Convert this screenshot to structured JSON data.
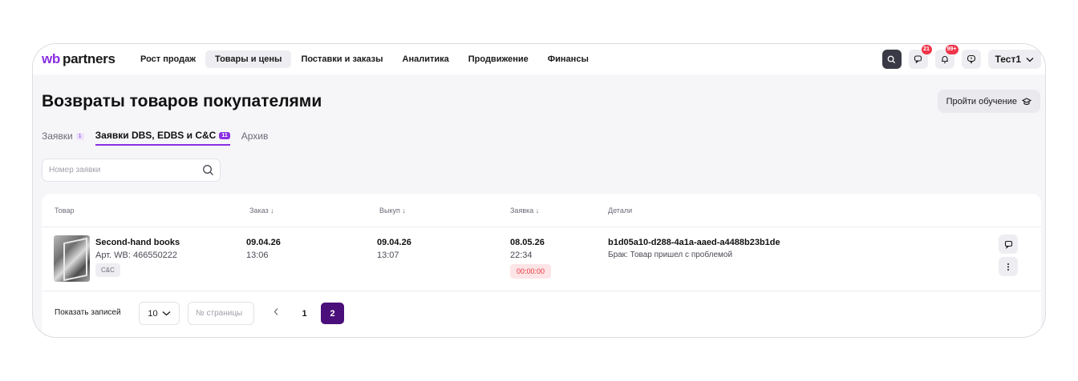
{
  "logo": {
    "wb": "wb",
    "partners": "partners"
  },
  "nav": [
    "Рост продаж",
    "Товары и цены",
    "Поставки и заказы",
    "Аналитика",
    "Продвижение",
    "Финансы"
  ],
  "nav_active_index": 1,
  "topbar": {
    "chat_badge": "21",
    "bell_badge": "99+",
    "user": "Тест1"
  },
  "page": {
    "title": "Возвраты товаров покупателями",
    "learn_button": "Пройти обучение"
  },
  "tabs": [
    {
      "label": "Заявки",
      "count": "1"
    },
    {
      "label": "Заявки DBS, EDBS и C&C",
      "count": "11"
    },
    {
      "label": "Архив"
    }
  ],
  "search": {
    "placeholder": "Номер заявки"
  },
  "table": {
    "headers": {
      "product": "Товар",
      "order": "Заказ ↓",
      "buyout": "Выкуп ↓",
      "request": "Заявка ↓",
      "details": "Детали"
    },
    "row": {
      "name": "Second-hand books",
      "article": "Арт. WB: 466550222",
      "tag": "C&C",
      "order_date": "09.04.26",
      "order_time": "13:06",
      "buyout_date": "09.04.26",
      "buyout_time": "13:07",
      "request_date": "08.05.26",
      "request_time": "22:34",
      "timer": "00:00:00",
      "details_id": "b1d05a10-d288-4a1a-aaed-a4488b23b1de",
      "details_reason": "Брак: Товар пришел с проблемой"
    }
  },
  "pager": {
    "label": "Показать записей",
    "per_page": "10",
    "page_placeholder": "№ страницы",
    "pages": [
      "1",
      "2"
    ],
    "current": "2"
  },
  "colors": {
    "accent": "#8a2fe3",
    "current_page": "#4a0f7a",
    "alert": "#e8363f"
  }
}
